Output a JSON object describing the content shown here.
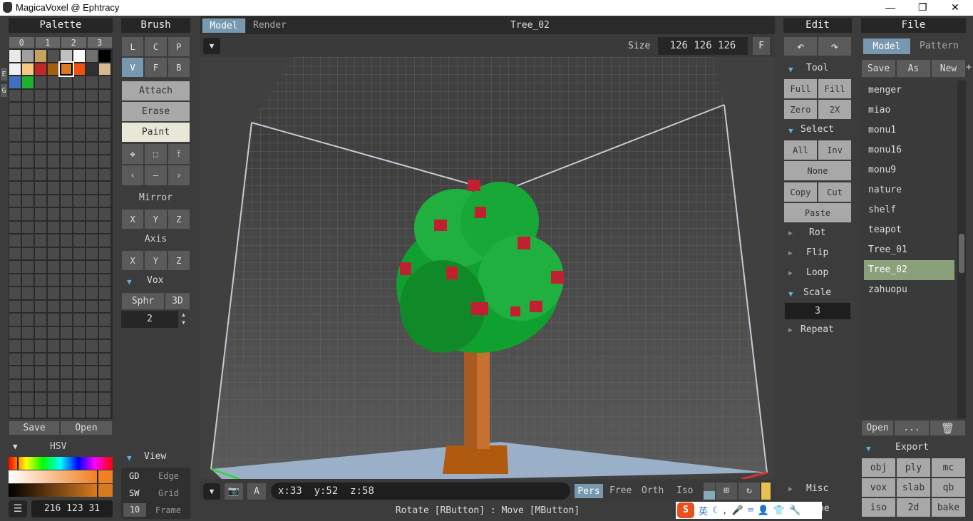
{
  "window": {
    "title": "MagicaVoxel @ Ephtracy",
    "minimize": "—",
    "maximize": "❐",
    "close": "✕"
  },
  "palette": {
    "title": "Palette",
    "columns": [
      "0",
      "1",
      "2",
      "3"
    ],
    "side_tabs": [
      "E",
      "G"
    ],
    "colors": [
      "#e8e8e8",
      "#a0a0a0",
      "#c8a060",
      "#505050",
      "#c0c0c0",
      "#ffffff",
      "#707070",
      "#000000",
      "#f0f0f0",
      "#f8c880",
      "#c02828",
      "#a06010",
      "#d87b1f",
      "#f05010",
      "#303030",
      "#d8b890",
      "#4070c0",
      "#20b030"
    ],
    "selected_index": 12,
    "save": "Save",
    "open": "Open"
  },
  "hsv": {
    "title": "HSV",
    "value": "216 123 31",
    "menu_icon": "menu-icon"
  },
  "brush": {
    "title": "Brush",
    "row1": [
      "L",
      "C",
      "P"
    ],
    "row2": [
      "V",
      "F",
      "B"
    ],
    "selected": "V",
    "modes": [
      "Attach",
      "Erase",
      "Paint"
    ],
    "active_mode": "Paint",
    "mirror": {
      "title": "Mirror",
      "axes": [
        "X",
        "Y",
        "Z"
      ]
    },
    "axis": {
      "title": "Axis",
      "axes": [
        "X",
        "Y",
        "Z"
      ]
    },
    "vox": {
      "title": "Vox",
      "options": [
        "Sphr",
        "3D"
      ],
      "value": "2"
    }
  },
  "view": {
    "title": "View",
    "rows": [
      {
        "k": "GD",
        "v": "Edge"
      },
      {
        "k": "SW",
        "v": "Grid"
      },
      {
        "k": "10",
        "v": "Frame"
      }
    ]
  },
  "viewport": {
    "tabs": [
      "Model",
      "Render"
    ],
    "active_tab": "Model",
    "name": "Tree_02",
    "size_label": "Size",
    "size": "126 126 126",
    "f": "F",
    "coords": {
      "x": "x:33",
      "y": "y:52",
      "z": "z:58"
    },
    "a": "A",
    "projections": [
      "Pers",
      "Free",
      "Orth",
      "Iso"
    ],
    "active_projection": "Pers",
    "status": "Rotate [RButton] : Move [MButton]"
  },
  "edit": {
    "title": "Edit",
    "tool": {
      "title": "Tool",
      "buttons": [
        "Full",
        "Fill",
        "Zero",
        "2X"
      ]
    },
    "select": {
      "title": "Select",
      "buttons": [
        "All",
        "Inv"
      ],
      "none": "None",
      "copy": "Copy",
      "cut": "Cut",
      "paste": "Paste"
    },
    "collapsed": [
      "Rot",
      "Flip",
      "Loop"
    ],
    "scale": {
      "title": "Scale",
      "value": "3"
    },
    "repeat": "Repeat",
    "misc": "Misc",
    "pe": "pe"
  },
  "file": {
    "title": "File",
    "tabs": [
      "Model",
      "Pattern"
    ],
    "active_tab": "Model",
    "actions": [
      "Save",
      "As",
      "New"
    ],
    "plus": "+",
    "items": [
      "menger",
      "miao",
      "monu1",
      "monu16",
      "monu9",
      "nature",
      "shelf",
      "teapot",
      "Tree_01",
      "Tree_02",
      "zahuopu"
    ],
    "selected": "Tree_02",
    "open": "Open",
    "more": "...",
    "export": {
      "title": "Export",
      "formats": [
        "obj",
        "ply",
        "mc",
        "vox",
        "slab",
        "qb",
        "iso",
        "2d",
        "bake"
      ]
    }
  },
  "ime": {
    "label": "英"
  }
}
